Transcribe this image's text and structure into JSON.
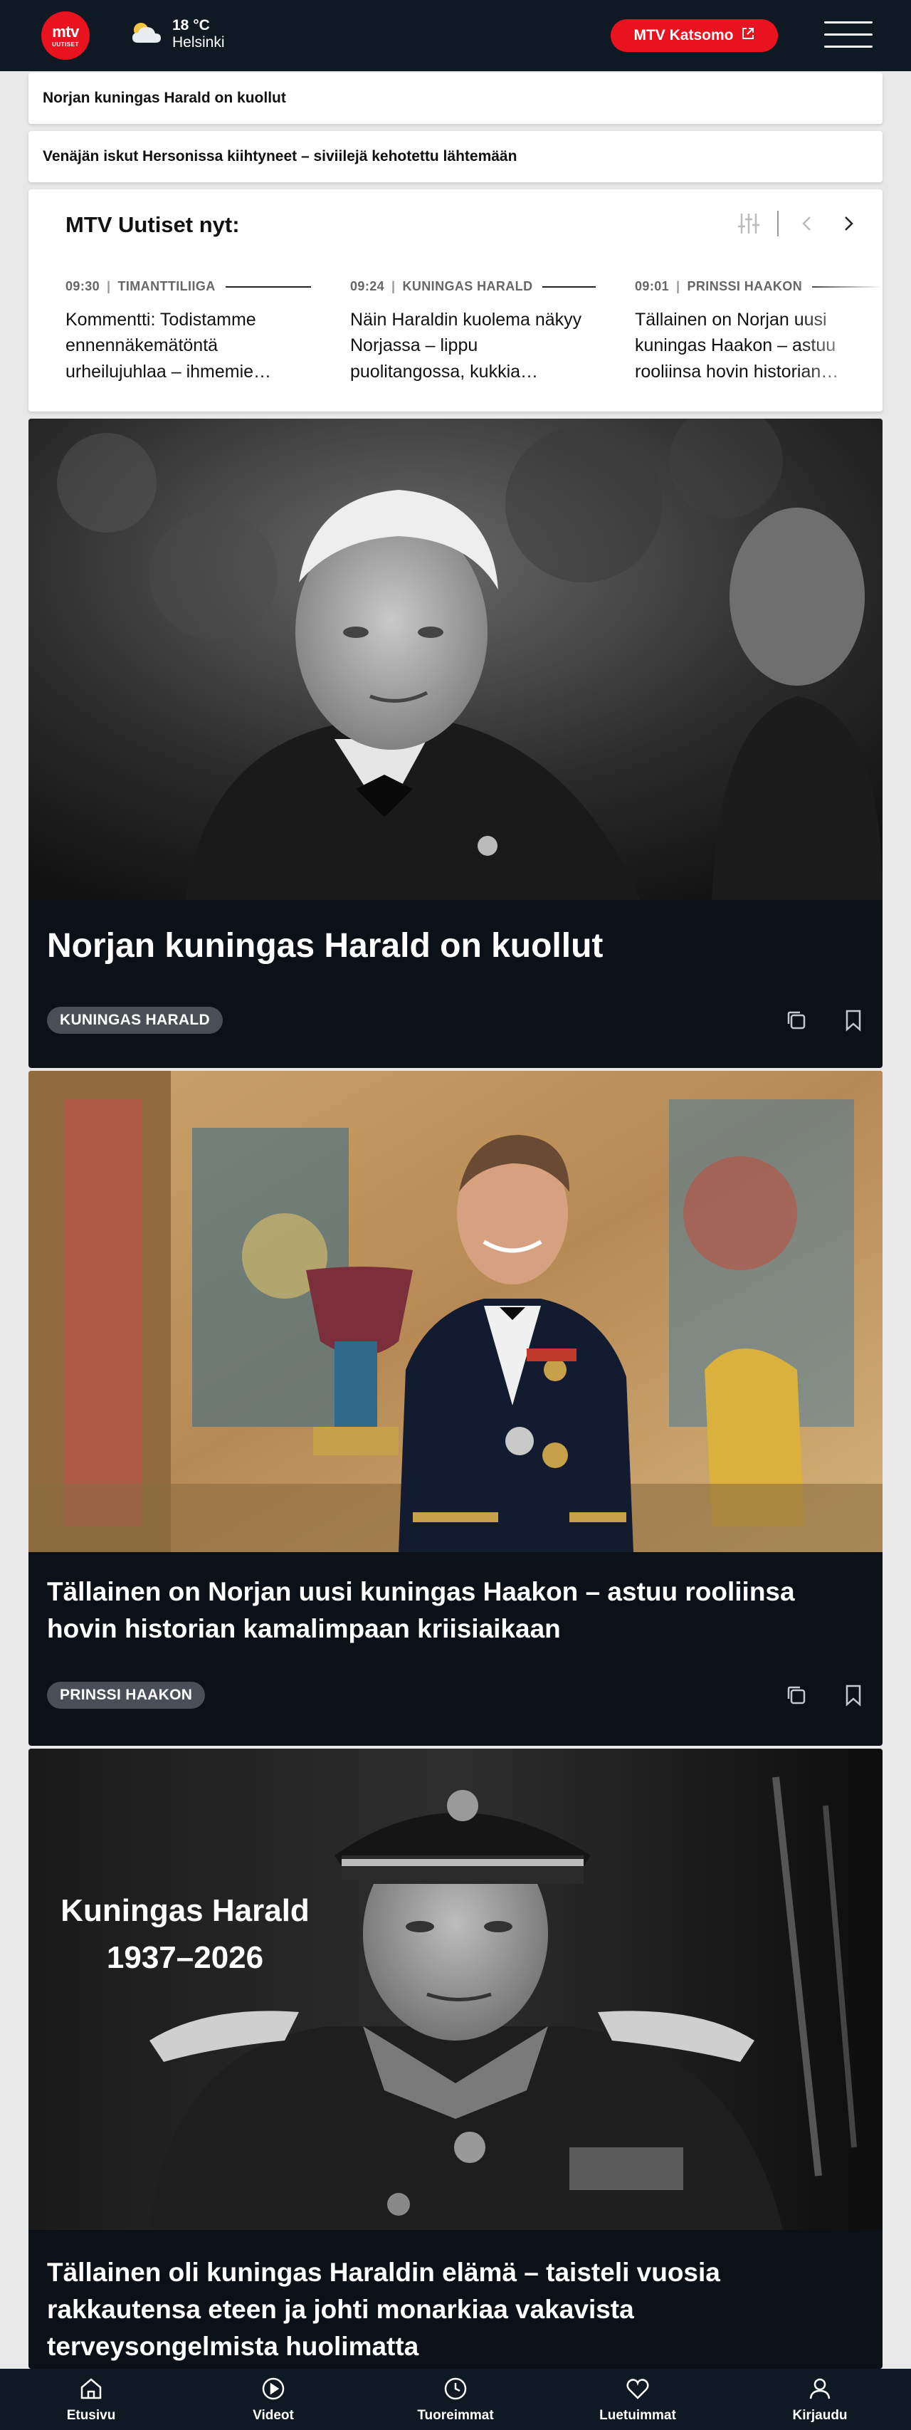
{
  "header": {
    "logo_top": "mtv",
    "logo_bottom": "UUTISET",
    "weather": {
      "temperature": "18 °C",
      "city": "Helsinki",
      "icon": "partly-cloudy-icon"
    },
    "katsomo_label": "MTV Katsomo",
    "menu_icon": "hamburger-menu-icon"
  },
  "breaking": [
    {
      "text": "Norjan kuningas Harald on kuollut"
    },
    {
      "text": "Venäjän iskut Hersonissa kiihtyneet – siviilejä kehotettu lähtemään"
    }
  ],
  "now": {
    "title": "MTV Uutiset nyt:",
    "items": [
      {
        "time": "09:30",
        "category": "TIMANTTILIIGA",
        "headline": "Kommentti: Todistamme ennennäkemätöntä urheilujuhlaa – ihmemie…"
      },
      {
        "time": "09:24",
        "category": "KUNINGAS HARALD",
        "headline": "Näin Haraldin kuolema näkyy Norjassa – lippu puolitangossa, kukkia…"
      },
      {
        "time": "09:01",
        "category": "PRINSSI HAAKON",
        "headline": "Tällainen on Norjan uusi kuningas Haakon – astuu rooliinsa hovin historian…"
      }
    ]
  },
  "articles": [
    {
      "title": "Norjan kuningas Harald on kuollut",
      "tag": "KUNINGAS HARALD"
    },
    {
      "title": "Tällainen on Norjan uusi kuningas Haakon – astuu rooliinsa hovin historian kamalimpaan kriisiaikaan",
      "tag": "PRINSSI HAAKON"
    },
    {
      "title": "Tällainen oli kuningas Haraldin elämä – taisteli vuosia rakkautensa eteen ja johti monarkiaa vakavista terveysongelmista huolimatta",
      "image_caption_line1": "Kuningas Harald",
      "image_caption_line2": "1937–2026"
    }
  ],
  "bottom_nav": [
    {
      "label": "Etusivu",
      "icon": "home-icon"
    },
    {
      "label": "Videot",
      "icon": "play-icon"
    },
    {
      "label": "Tuoreimmat",
      "icon": "clock-icon"
    },
    {
      "label": "Luetuimmat",
      "icon": "heart-icon"
    },
    {
      "label": "Kirjaudu",
      "icon": "user-icon"
    }
  ],
  "colors": {
    "brand_red": "#e8131f",
    "header_bg": "#0f1923",
    "card_bg": "#0c1117",
    "tag_bg": "#4a4f57"
  }
}
